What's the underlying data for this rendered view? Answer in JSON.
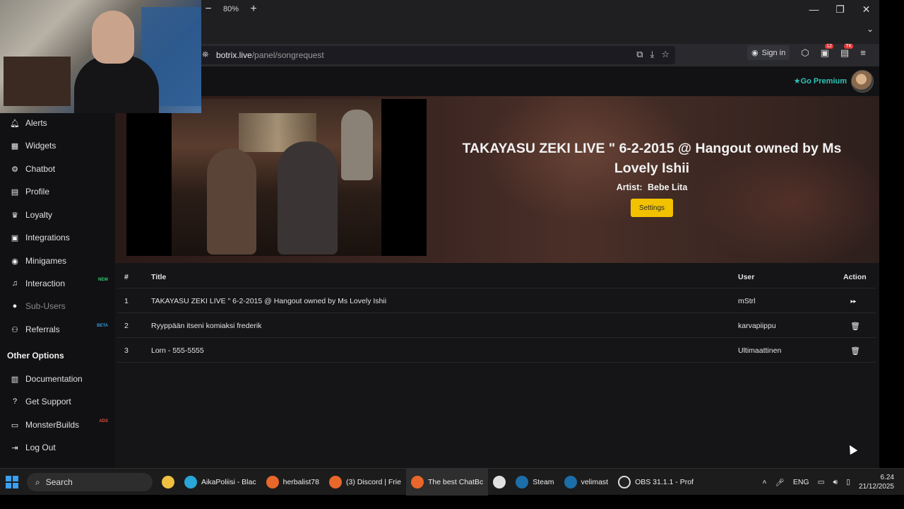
{
  "browser": {
    "zoom": {
      "minus": "−",
      "level": "80%",
      "plus": "+"
    },
    "window_controls": {
      "minimize": "—",
      "restore": "❐",
      "close": "✕"
    },
    "tab_list_chevron": "⌄",
    "url": {
      "domain": "botrix.live",
      "path": "/panel/songrequest"
    },
    "sign_in_label": "Sign in",
    "ext_badges": {
      "badge1": "12",
      "badge2": "TK"
    }
  },
  "header": {
    "go_premium": "Go Premium"
  },
  "sidebar": {
    "items": [
      {
        "label": "Alerts",
        "icon": "bell-icon"
      },
      {
        "label": "Widgets",
        "icon": "grid-icon"
      },
      {
        "label": "Chatbot",
        "icon": "robot-icon"
      },
      {
        "label": "Profile",
        "icon": "id-card-icon"
      },
      {
        "label": "Loyalty",
        "icon": "trophy-icon"
      },
      {
        "label": "Integrations",
        "icon": "plug-icon"
      },
      {
        "label": "Minigames",
        "icon": "gamepad-icon"
      },
      {
        "label": "Interaction",
        "icon": "music-icon",
        "tag": "NEW"
      },
      {
        "label": "Sub-Users",
        "icon": "user-icon"
      },
      {
        "label": "Referrals",
        "icon": "users-icon",
        "tag": "BETA"
      }
    ],
    "other_title": "Other Options",
    "other_items": [
      {
        "label": "Documentation",
        "icon": "book-icon"
      },
      {
        "label": "Get Support",
        "icon": "question-icon"
      },
      {
        "label": "MonsterBuilds",
        "icon": "laptop-icon",
        "tag": "ADS"
      },
      {
        "label": "Log Out",
        "icon": "logout-icon"
      }
    ]
  },
  "now_playing": {
    "title": "TAKAYASU ZEKI LIVE \" 6-2-2015 @ Hangout owned by Ms Lovely Ishii",
    "artist_label": "Artist:",
    "artist": "Bebe Lita",
    "settings_label": "Settings"
  },
  "queue": {
    "headers": {
      "num": "#",
      "title": "Title",
      "user": "User",
      "action": "Action"
    },
    "rows": [
      {
        "num": "1",
        "title": "TAKAYASU ZEKI LIVE \" 6-2-2015 @ Hangout owned by Ms Lovely Ishii",
        "user": "mStrl",
        "action": "skip"
      },
      {
        "num": "2",
        "title": "Ryyppään itseni komiaksi frederik",
        "user": "karvapiippu",
        "action": "delete"
      },
      {
        "num": "3",
        "title": "Lorn - 555-5555",
        "user": "Ultimaattinen",
        "action": "delete"
      }
    ]
  },
  "taskbar": {
    "search_label": "Search",
    "apps": [
      {
        "label": "",
        "icon": "folder-icon"
      },
      {
        "label": "AikaPoliisi - Blac",
        "icon": "edge-icon"
      },
      {
        "label": "herbalist78",
        "icon": "firefox-icon"
      },
      {
        "label": "(3) Discord | Frie",
        "icon": "firefox-icon"
      },
      {
        "label": "The best ChatBc",
        "icon": "firefox-icon"
      },
      {
        "label": "",
        "icon": "store-icon"
      },
      {
        "label": "Steam",
        "icon": "steam-icon"
      },
      {
        "label": "velimast",
        "icon": "steam-icon"
      },
      {
        "label": "OBS 31.1.1 - Prof",
        "icon": "obs-icon"
      }
    ],
    "lang": "ENG",
    "time": "6.24",
    "date": "21/12/2025"
  },
  "colors": {
    "accent_teal": "#2ec4b6",
    "settings_yellow": "#f2c200",
    "tag_new": "#2ecc71",
    "tag_beta": "#3498db",
    "tag_ads": "#e74c3c"
  }
}
